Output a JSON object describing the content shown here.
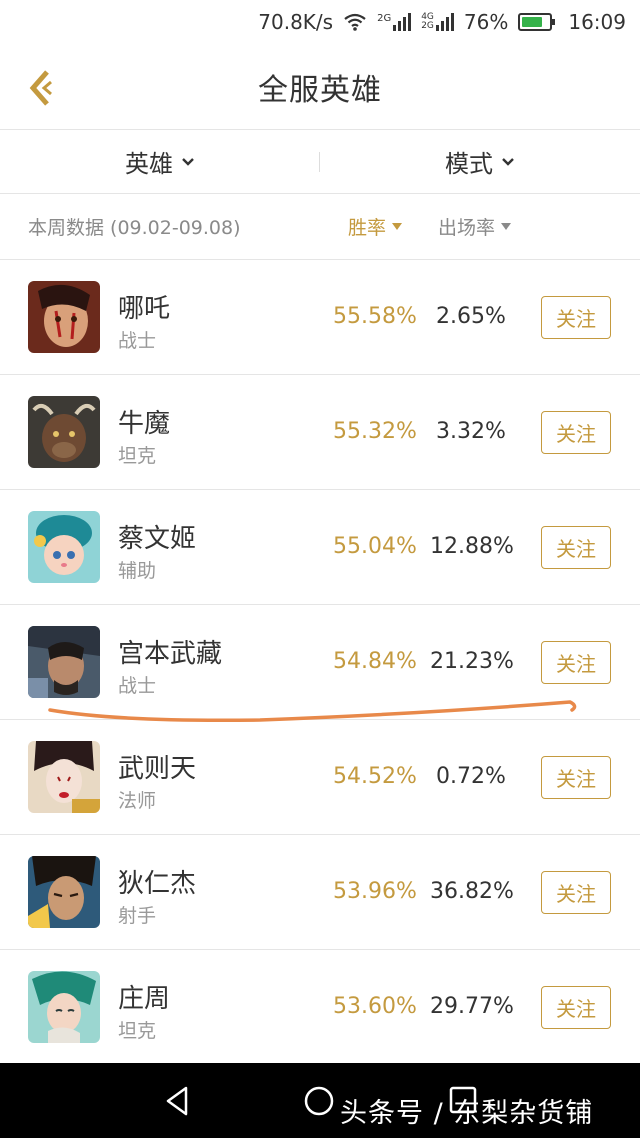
{
  "status_bar": {
    "speed": "70.8K/s",
    "network_2g": "2G",
    "network_4g": "4G",
    "battery_percent": "76%",
    "battery_level": 0.76,
    "time": "16:09"
  },
  "header": {
    "title": "全服英雄",
    "back_icon": "chevron-left-icon"
  },
  "filters": {
    "hero_label": "英雄",
    "mode_label": "模式"
  },
  "stats": {
    "week_label": "本周数据 (09.02-09.08)",
    "win_rate_label": "胜率",
    "pick_rate_label": "出场率"
  },
  "heroes": [
    {
      "name": "哪吒",
      "role": "战士",
      "win_rate": "55.58%",
      "pick_rate": "2.65%",
      "follow": "关注"
    },
    {
      "name": "牛魔",
      "role": "坦克",
      "win_rate": "55.32%",
      "pick_rate": "3.32%",
      "follow": "关注"
    },
    {
      "name": "蔡文姬",
      "role": "辅助",
      "win_rate": "55.04%",
      "pick_rate": "12.88%",
      "follow": "关注"
    },
    {
      "name": "宫本武藏",
      "role": "战士",
      "win_rate": "54.84%",
      "pick_rate": "21.23%",
      "follow": "关注"
    },
    {
      "name": "武则天",
      "role": "法师",
      "win_rate": "54.52%",
      "pick_rate": "0.72%",
      "follow": "关注"
    },
    {
      "name": "狄仁杰",
      "role": "射手",
      "win_rate": "53.96%",
      "pick_rate": "36.82%",
      "follow": "关注"
    },
    {
      "name": "庄周",
      "role": "坦克",
      "win_rate": "53.60%",
      "pick_rate": "29.77%",
      "follow": "关注"
    }
  ],
  "bottom_nav": {
    "watermark": "头条号 / 东梨杂货铺"
  },
  "colors": {
    "accent": "#c49a3f",
    "annotation": "#e8894a"
  }
}
